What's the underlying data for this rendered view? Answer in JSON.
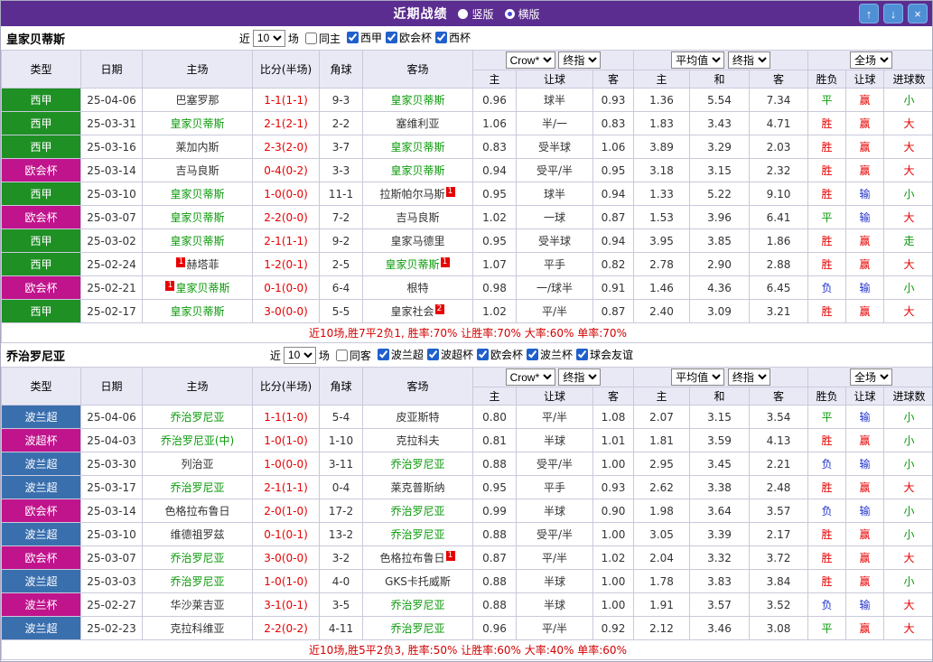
{
  "titlebar": {
    "title": "近期战绩",
    "radios": [
      {
        "label": "竖版",
        "selected": false
      },
      {
        "label": "横版",
        "selected": true
      }
    ],
    "buttons": [
      {
        "name": "up",
        "glyph": "↑"
      },
      {
        "name": "down",
        "glyph": "↓"
      },
      {
        "name": "close",
        "glyph": "×"
      }
    ]
  },
  "labels": {
    "near": "近",
    "games": "场"
  },
  "selects": {
    "bookmaker": "Crow*",
    "final": "终指",
    "average": "平均值",
    "full": "全场"
  },
  "columns": [
    "类型",
    "日期",
    "主场",
    "比分(半场)",
    "角球",
    "客场",
    "主",
    "让球",
    "客",
    "主",
    "和",
    "客",
    "胜负",
    "让球",
    "进球数"
  ],
  "league_colors": {
    "西甲": "#1e9024",
    "欧会杯": "#c0148c",
    "西杯": "#c0148c",
    "波兰超": "#3a6fae",
    "波超杯": "#c0148c",
    "波兰杯": "#c0148c"
  },
  "result_colors": {
    "胜": "#e60000",
    "平": "#0b9a0b",
    "负": "#2233cc",
    "赢": "#e60000",
    "输": "#2233cc",
    "走": "#0b9a0b",
    "大": "#e60000",
    "小": "#0b9a0b"
  },
  "sections": [
    {
      "team": "皇家贝蒂斯",
      "filter": {
        "count": "10",
        "same_label": "同主",
        "same_checked": false,
        "leagues": [
          {
            "label": "西甲",
            "checked": true
          },
          {
            "label": "欧会杯",
            "checked": true
          },
          {
            "label": "西杯",
            "checked": true
          }
        ]
      },
      "rows": [
        {
          "league": "西甲",
          "date": "25-04-06",
          "home": {
            "name": "巴塞罗那",
            "focus": false,
            "card": 0
          },
          "score": "1-1(1-1)",
          "corner": "9-3",
          "away": {
            "name": "皇家贝蒂斯",
            "focus": true,
            "card": 0
          },
          "asia": [
            "0.96",
            "球半",
            "0.93"
          ],
          "euro": [
            "1.36",
            "5.54",
            "7.34"
          ],
          "result": "平",
          "handicap": "赢",
          "goals": "小"
        },
        {
          "league": "西甲",
          "date": "25-03-31",
          "home": {
            "name": "皇家贝蒂斯",
            "focus": true,
            "card": 0
          },
          "score": "2-1(2-1)",
          "corner": "2-2",
          "away": {
            "name": "塞维利亚",
            "focus": false,
            "card": 0
          },
          "asia": [
            "1.06",
            "半/一",
            "0.83"
          ],
          "euro": [
            "1.83",
            "3.43",
            "4.71"
          ],
          "result": "胜",
          "handicap": "赢",
          "goals": "大"
        },
        {
          "league": "西甲",
          "date": "25-03-16",
          "home": {
            "name": "莱加内斯",
            "focus": false,
            "card": 0
          },
          "score": "2-3(2-0)",
          "corner": "3-7",
          "away": {
            "name": "皇家贝蒂斯",
            "focus": true,
            "card": 0
          },
          "asia": [
            "0.83",
            "受半球",
            "1.06"
          ],
          "euro": [
            "3.89",
            "3.29",
            "2.03"
          ],
          "result": "胜",
          "handicap": "赢",
          "goals": "大"
        },
        {
          "league": "欧会杯",
          "date": "25-03-14",
          "home": {
            "name": "吉马良斯",
            "focus": false,
            "card": 0
          },
          "score": "0-4(0-2)",
          "corner": "3-3",
          "away": {
            "name": "皇家贝蒂斯",
            "focus": true,
            "card": 0
          },
          "asia": [
            "0.94",
            "受平/半",
            "0.95"
          ],
          "euro": [
            "3.18",
            "3.15",
            "2.32"
          ],
          "result": "胜",
          "handicap": "赢",
          "goals": "大"
        },
        {
          "league": "西甲",
          "date": "25-03-10",
          "home": {
            "name": "皇家贝蒂斯",
            "focus": true,
            "card": 0
          },
          "score": "1-0(0-0)",
          "corner": "11-1",
          "away": {
            "name": "拉斯帕尔马斯",
            "focus": false,
            "card": 1
          },
          "asia": [
            "0.95",
            "球半",
            "0.94"
          ],
          "euro": [
            "1.33",
            "5.22",
            "9.10"
          ],
          "result": "胜",
          "handicap": "输",
          "goals": "小"
        },
        {
          "league": "欧会杯",
          "date": "25-03-07",
          "home": {
            "name": "皇家贝蒂斯",
            "focus": true,
            "card": 0
          },
          "score": "2-2(0-0)",
          "corner": "7-2",
          "away": {
            "name": "吉马良斯",
            "focus": false,
            "card": 0
          },
          "asia": [
            "1.02",
            "一球",
            "0.87"
          ],
          "euro": [
            "1.53",
            "3.96",
            "6.41"
          ],
          "result": "平",
          "handicap": "输",
          "goals": "大"
        },
        {
          "league": "西甲",
          "date": "25-03-02",
          "home": {
            "name": "皇家贝蒂斯",
            "focus": true,
            "card": 0
          },
          "score": "2-1(1-1)",
          "corner": "9-2",
          "away": {
            "name": "皇家马德里",
            "focus": false,
            "card": 0
          },
          "asia": [
            "0.95",
            "受半球",
            "0.94"
          ],
          "euro": [
            "3.95",
            "3.85",
            "1.86"
          ],
          "result": "胜",
          "handicap": "赢",
          "goals": "走"
        },
        {
          "league": "西甲",
          "date": "25-02-24",
          "home": {
            "name": "赫塔菲",
            "focus": false,
            "card": 1
          },
          "score": "1-2(0-1)",
          "corner": "2-5",
          "away": {
            "name": "皇家贝蒂斯",
            "focus": true,
            "card": 1
          },
          "asia": [
            "1.07",
            "平手",
            "0.82"
          ],
          "euro": [
            "2.78",
            "2.90",
            "2.88"
          ],
          "result": "胜",
          "handicap": "赢",
          "goals": "大"
        },
        {
          "league": "欧会杯",
          "date": "25-02-21",
          "home": {
            "name": "皇家贝蒂斯",
            "focus": true,
            "card": 1
          },
          "score": "0-1(0-0)",
          "corner": "6-4",
          "away": {
            "name": "根特",
            "focus": false,
            "card": 0
          },
          "asia": [
            "0.98",
            "一/球半",
            "0.91"
          ],
          "euro": [
            "1.46",
            "4.36",
            "6.45"
          ],
          "result": "负",
          "handicap": "输",
          "goals": "小"
        },
        {
          "league": "西甲",
          "date": "25-02-17",
          "home": {
            "name": "皇家贝蒂斯",
            "focus": true,
            "card": 0
          },
          "score": "3-0(0-0)",
          "corner": "5-5",
          "away": {
            "name": "皇家社会",
            "focus": false,
            "card": 2
          },
          "asia": [
            "1.02",
            "平/半",
            "0.87"
          ],
          "euro": [
            "2.40",
            "3.09",
            "3.21"
          ],
          "result": "胜",
          "handicap": "赢",
          "goals": "大"
        }
      ],
      "summary": "近10场,胜7平2负1, 胜率:70% 让胜率:70% 大率:60% 单率:70%"
    },
    {
      "team": "乔治罗尼亚",
      "filter": {
        "count": "10",
        "same_label": "同客",
        "same_checked": false,
        "leagues": [
          {
            "label": "波兰超",
            "checked": true
          },
          {
            "label": "波超杯",
            "checked": true
          },
          {
            "label": "欧会杯",
            "checked": true
          },
          {
            "label": "波兰杯",
            "checked": true
          },
          {
            "label": "球会友谊",
            "checked": true
          }
        ]
      },
      "rows": [
        {
          "league": "波兰超",
          "date": "25-04-06",
          "home": {
            "name": "乔治罗尼亚",
            "focus": true,
            "card": 0
          },
          "score": "1-1(1-0)",
          "corner": "5-4",
          "away": {
            "name": "皮亚斯特",
            "focus": false,
            "card": 0
          },
          "asia": [
            "0.80",
            "平/半",
            "1.08"
          ],
          "euro": [
            "2.07",
            "3.15",
            "3.54"
          ],
          "result": "平",
          "handicap": "输",
          "goals": "小"
        },
        {
          "league": "波超杯",
          "date": "25-04-03",
          "home": {
            "name": "乔治罗尼亚(中)",
            "focus": true,
            "card": 0
          },
          "score": "1-0(1-0)",
          "corner": "1-10",
          "away": {
            "name": "克拉科夫",
            "focus": false,
            "card": 0
          },
          "asia": [
            "0.81",
            "半球",
            "1.01"
          ],
          "euro": [
            "1.81",
            "3.59",
            "4.13"
          ],
          "result": "胜",
          "handicap": "赢",
          "goals": "小"
        },
        {
          "league": "波兰超",
          "date": "25-03-30",
          "home": {
            "name": "列治亚",
            "focus": false,
            "card": 0
          },
          "score": "1-0(0-0)",
          "corner": "3-11",
          "away": {
            "name": "乔治罗尼亚",
            "focus": true,
            "card": 0
          },
          "asia": [
            "0.88",
            "受平/半",
            "1.00"
          ],
          "euro": [
            "2.95",
            "3.45",
            "2.21"
          ],
          "result": "负",
          "handicap": "输",
          "goals": "小"
        },
        {
          "league": "波兰超",
          "date": "25-03-17",
          "home": {
            "name": "乔治罗尼亚",
            "focus": true,
            "card": 0
          },
          "score": "2-1(1-1)",
          "corner": "0-4",
          "away": {
            "name": "莱克普斯纳",
            "focus": false,
            "card": 0
          },
          "asia": [
            "0.95",
            "平手",
            "0.93"
          ],
          "euro": [
            "2.62",
            "3.38",
            "2.48"
          ],
          "result": "胜",
          "handicap": "赢",
          "goals": "大"
        },
        {
          "league": "欧会杯",
          "date": "25-03-14",
          "home": {
            "name": "色格拉布鲁日",
            "focus": false,
            "card": 0
          },
          "score": "2-0(1-0)",
          "corner": "17-2",
          "away": {
            "name": "乔治罗尼亚",
            "focus": true,
            "card": 0
          },
          "asia": [
            "0.99",
            "半球",
            "0.90"
          ],
          "euro": [
            "1.98",
            "3.64",
            "3.57"
          ],
          "result": "负",
          "handicap": "输",
          "goals": "小"
        },
        {
          "league": "波兰超",
          "date": "25-03-10",
          "home": {
            "name": "维德祖罗兹",
            "focus": false,
            "card": 0
          },
          "score": "0-1(0-1)",
          "corner": "13-2",
          "away": {
            "name": "乔治罗尼亚",
            "focus": true,
            "card": 0
          },
          "asia": [
            "0.88",
            "受平/半",
            "1.00"
          ],
          "euro": [
            "3.05",
            "3.39",
            "2.17"
          ],
          "result": "胜",
          "handicap": "赢",
          "goals": "小"
        },
        {
          "league": "欧会杯",
          "date": "25-03-07",
          "home": {
            "name": "乔治罗尼亚",
            "focus": true,
            "card": 0
          },
          "score": "3-0(0-0)",
          "corner": "3-2",
          "away": {
            "name": "色格拉布鲁日",
            "focus": false,
            "card": 1
          },
          "asia": [
            "0.87",
            "平/半",
            "1.02"
          ],
          "euro": [
            "2.04",
            "3.32",
            "3.72"
          ],
          "result": "胜",
          "handicap": "赢",
          "goals": "大"
        },
        {
          "league": "波兰超",
          "date": "25-03-03",
          "home": {
            "name": "乔治罗尼亚",
            "focus": true,
            "card": 0
          },
          "score": "1-0(1-0)",
          "corner": "4-0",
          "away": {
            "name": "GKS卡托威斯",
            "focus": false,
            "card": 0
          },
          "asia": [
            "0.88",
            "半球",
            "1.00"
          ],
          "euro": [
            "1.78",
            "3.83",
            "3.84"
          ],
          "result": "胜",
          "handicap": "赢",
          "goals": "小"
        },
        {
          "league": "波兰杯",
          "date": "25-02-27",
          "home": {
            "name": "华沙莱吉亚",
            "focus": false,
            "card": 0
          },
          "score": "3-1(0-1)",
          "corner": "3-5",
          "away": {
            "name": "乔治罗尼亚",
            "focus": true,
            "card": 0
          },
          "asia": [
            "0.88",
            "半球",
            "1.00"
          ],
          "euro": [
            "1.91",
            "3.57",
            "3.52"
          ],
          "result": "负",
          "handicap": "输",
          "goals": "大"
        },
        {
          "league": "波兰超",
          "date": "25-02-23",
          "home": {
            "name": "克拉科维亚",
            "focus": false,
            "card": 0
          },
          "score": "2-2(0-2)",
          "corner": "4-11",
          "away": {
            "name": "乔治罗尼亚",
            "focus": true,
            "card": 0
          },
          "asia": [
            "0.96",
            "平/半",
            "0.92"
          ],
          "euro": [
            "2.12",
            "3.46",
            "3.08"
          ],
          "result": "平",
          "handicap": "赢",
          "goals": "大"
        }
      ],
      "summary": "近10场,胜5平2负3, 胜率:50% 让胜率:60% 大率:40% 单率:60%"
    }
  ]
}
